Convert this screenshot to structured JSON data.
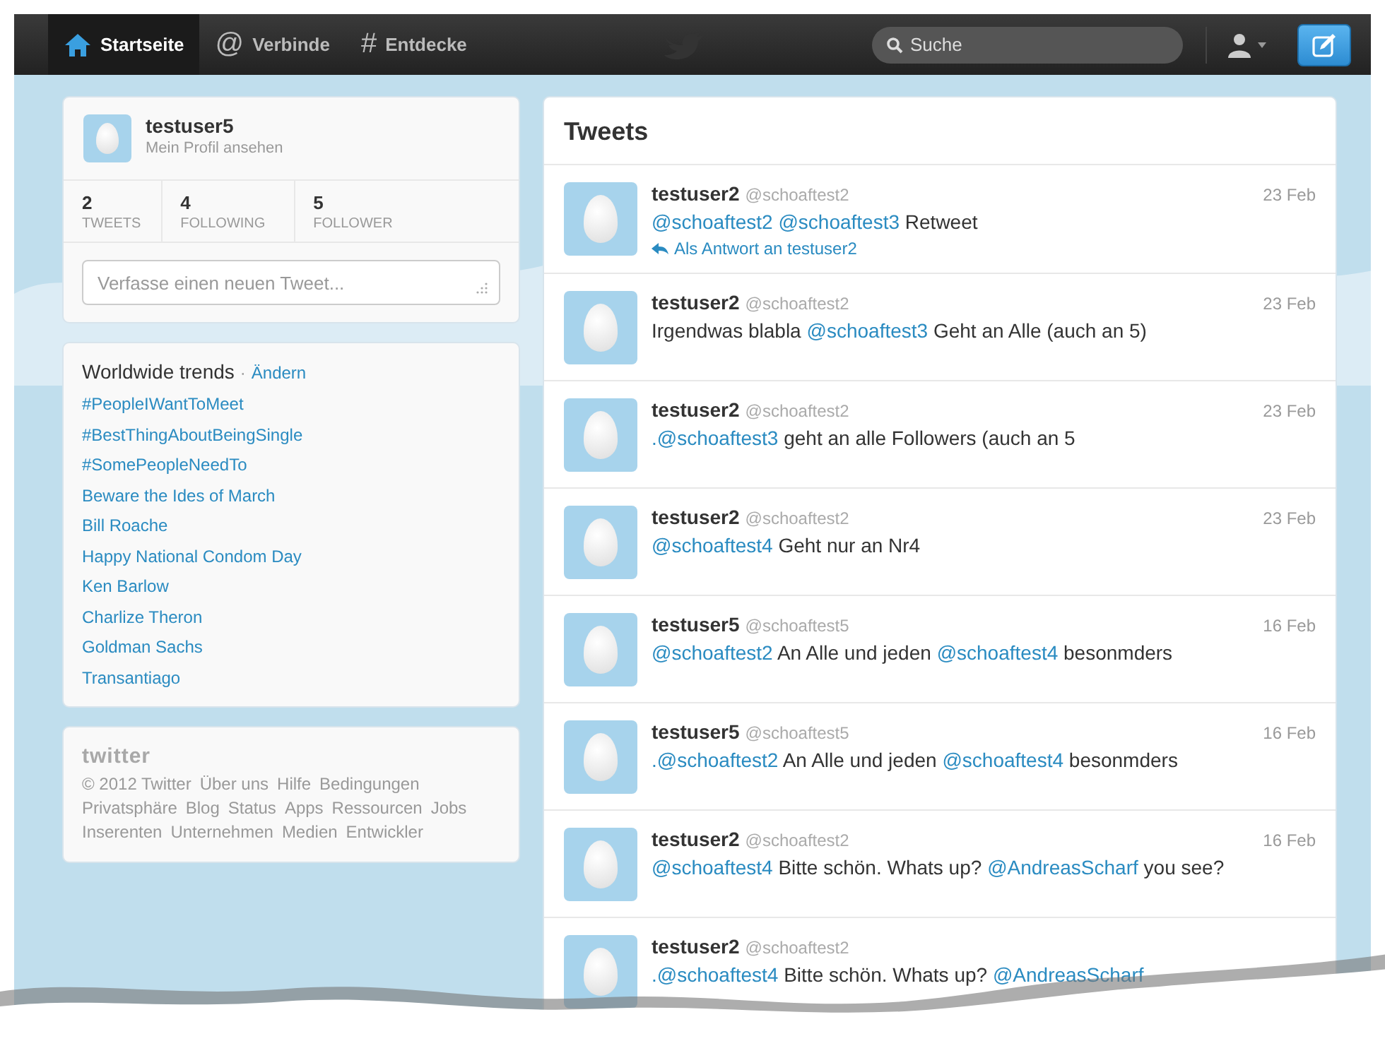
{
  "nav": {
    "items": [
      {
        "kind": "home",
        "label": "Startseite",
        "selected": true
      },
      {
        "kind": "char",
        "glyph": "@",
        "label": "Verbinde",
        "selected": false
      },
      {
        "kind": "char",
        "glyph": "#",
        "label": "Entdecke",
        "selected": false
      }
    ],
    "search": {
      "placeholder": "Suche"
    }
  },
  "profile": {
    "name": "testuser5",
    "link": "Mein Profil ansehen",
    "stats": [
      {
        "value": "2",
        "label": "TWEETS"
      },
      {
        "value": "4",
        "label": "FOLLOWING"
      },
      {
        "value": "5",
        "label": "FOLLOWER"
      }
    ],
    "compose": {
      "placeholder": "Verfasse einen neuen Tweet..."
    }
  },
  "trends": {
    "title": "Worldwide trends",
    "separator": "·",
    "change": "Ändern",
    "items": [
      "#PeopleIWantToMeet",
      "#BestThingAboutBeingSingle",
      "#SomePeopleNeedTo",
      "Beware the Ides of March",
      "Bill Roache",
      "Happy National Condom Day",
      "Ken Barlow",
      "Charlize Theron",
      "Goldman Sachs",
      "Transantiago"
    ]
  },
  "footer": {
    "logo": "twitter",
    "links": [
      "© 2012 Twitter",
      "Über uns",
      "Hilfe",
      "Bedingungen",
      "Privatsphäre",
      "Blog",
      "Status",
      "Apps",
      "Ressourcen",
      "Jobs",
      "Inserenten",
      "Unternehmen",
      "Medien",
      "Entwickler"
    ]
  },
  "tweets": {
    "title": "Tweets",
    "items": [
      {
        "name": "testuser2",
        "handle": "@schoaftest2",
        "date": "23 Feb",
        "text": [
          {
            "kind": "mention",
            "text": "@schoaftest2"
          },
          {
            "kind": "mention",
            "text": "@schoaftest3"
          },
          {
            "kind": "plain",
            "text": "Retweet"
          }
        ],
        "reply": "Als Antwort an testuser2"
      },
      {
        "name": "testuser2",
        "handle": "@schoaftest2",
        "date": "23 Feb",
        "text": [
          {
            "kind": "plain",
            "text": "Irgendwas blabla"
          },
          {
            "kind": "mention",
            "text": "@schoaftest3"
          },
          {
            "kind": "plain",
            "text": "Geht an Alle (auch an 5)"
          }
        ]
      },
      {
        "name": "testuser2",
        "handle": "@schoaftest2",
        "date": "23 Feb",
        "text": [
          {
            "kind": "mention",
            "text": ".@schoaftest3"
          },
          {
            "kind": "plain",
            "text": "geht an alle Followers (auch an 5"
          }
        ]
      },
      {
        "name": "testuser2",
        "handle": "@schoaftest2",
        "date": "23 Feb",
        "text": [
          {
            "kind": "mention",
            "text": "@schoaftest4"
          },
          {
            "kind": "plain",
            "text": "Geht nur an Nr4"
          }
        ]
      },
      {
        "name": "testuser5",
        "handle": "@schoaftest5",
        "date": "16 Feb",
        "text": [
          {
            "kind": "mention",
            "text": "@schoaftest2"
          },
          {
            "kind": "plain",
            "text": "An Alle und jeden"
          },
          {
            "kind": "mention",
            "text": "@schoaftest4"
          },
          {
            "kind": "plain",
            "text": "besonmders"
          }
        ]
      },
      {
        "name": "testuser5",
        "handle": "@schoaftest5",
        "date": "16 Feb",
        "text": [
          {
            "kind": "mention",
            "text": ".@schoaftest2"
          },
          {
            "kind": "plain",
            "text": "An Alle und jeden"
          },
          {
            "kind": "mention",
            "text": "@schoaftest4"
          },
          {
            "kind": "plain",
            "text": "besonmders"
          }
        ]
      },
      {
        "name": "testuser2",
        "handle": "@schoaftest2",
        "date": "16 Feb",
        "text": [
          {
            "kind": "mention",
            "text": "@schoaftest4"
          },
          {
            "kind": "plain",
            "text": "Bitte schön. Whats up?"
          },
          {
            "kind": "mention",
            "text": "@AndreasScharf"
          },
          {
            "kind": "plain",
            "text": "you see?"
          }
        ]
      },
      {
        "name": "testuser2",
        "handle": "@schoaftest2",
        "text": [
          {
            "kind": "mention",
            "text": ".@schoaftest4"
          },
          {
            "kind": "plain",
            "text": "Bitte schön. Whats up?"
          },
          {
            "kind": "mention",
            "text": "@AndreasScharf"
          }
        ]
      }
    ]
  }
}
